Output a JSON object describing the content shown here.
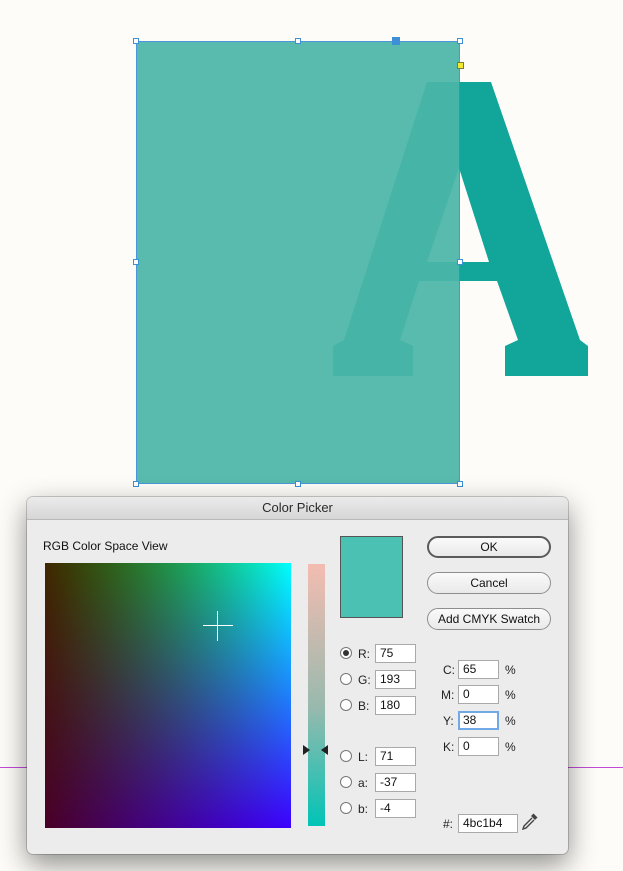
{
  "dialog": {
    "title": "Color Picker",
    "view_label": "RGB Color Space View",
    "buttons": {
      "ok": "OK",
      "cancel": "Cancel",
      "add_swatch": "Add CMYK Swatch"
    },
    "current_color": "#4bc1b4",
    "rgb": [
      {
        "label": "R:",
        "value": "75",
        "selected": true
      },
      {
        "label": "G:",
        "value": "193",
        "selected": false
      },
      {
        "label": "B:",
        "value": "180",
        "selected": false
      }
    ],
    "lab": [
      {
        "label": "L:",
        "value": "71"
      },
      {
        "label": "a:",
        "value": "-37"
      },
      {
        "label": "b:",
        "value": "-4"
      }
    ],
    "cmyk": [
      {
        "label": "C:",
        "value": "65",
        "unit": "%"
      },
      {
        "label": "M:",
        "value": "0",
        "unit": "%"
      },
      {
        "label": "Y:",
        "value": "38",
        "unit": "%"
      },
      {
        "label": "K:",
        "value": "0",
        "unit": "%"
      }
    ],
    "hex_label": "#:",
    "hex_value": "4bc1b4"
  },
  "canvas": {
    "rect_color": "#4bb6a8",
    "letter": "A",
    "letter_color": "#12a69b"
  }
}
